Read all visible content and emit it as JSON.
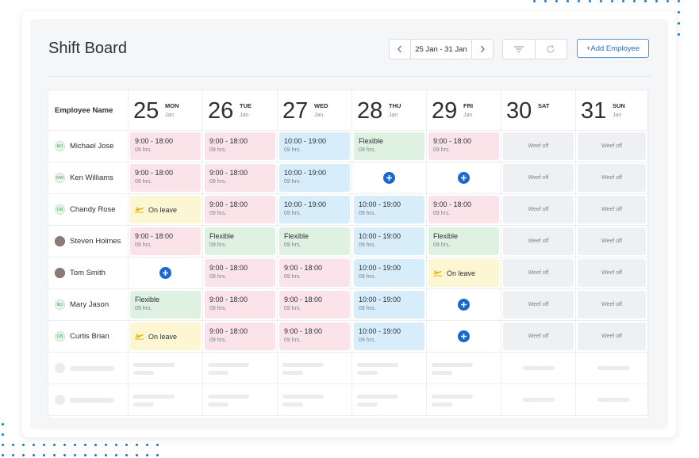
{
  "app": {
    "title": "Shift Board",
    "date_range": "25 Jan - 31 Jan",
    "add_employee_label": "+Add Employee",
    "accent_color": "#1769d1"
  },
  "icons": {
    "prev": "chevron-left-icon",
    "next": "chevron-right-icon",
    "filter": "filter-icon",
    "refresh": "refresh-icon",
    "add": "plus-circle-icon",
    "leave": "plane-icon"
  },
  "grid": {
    "employee_header": "Employee Name",
    "days": [
      {
        "num": "25",
        "name": "MON",
        "month": "Jan"
      },
      {
        "num": "26",
        "name": "TUE",
        "month": "Jan"
      },
      {
        "num": "27",
        "name": "WED",
        "month": "Jan"
      },
      {
        "num": "28",
        "name": "THU",
        "month": "Jan"
      },
      {
        "num": "29",
        "name": "FRI",
        "month": "Jan"
      },
      {
        "num": "30",
        "name": "SAT",
        "month": ""
      },
      {
        "num": "31",
        "name": "SUN",
        "month": "Jan"
      }
    ],
    "rows": [
      {
        "initials": "MJ",
        "name": "Michael Jose",
        "cells": [
          {
            "kind": "shift",
            "color": "pink",
            "time": "9:00 - 18:00",
            "hours": "09 hrs."
          },
          {
            "kind": "shift",
            "color": "pink",
            "time": "9:00 - 18:00",
            "hours": "09 hrs."
          },
          {
            "kind": "shift",
            "color": "blue",
            "time": "10:00 - 19:00",
            "hours": "09 hrs."
          },
          {
            "kind": "shift",
            "color": "green",
            "time": "Flexible",
            "hours": "09 hrs."
          },
          {
            "kind": "shift",
            "color": "pink",
            "time": "9:00 - 18:00",
            "hours": "09 hrs."
          },
          {
            "kind": "off",
            "label": "Weef off"
          },
          {
            "kind": "off",
            "label": "Weef off"
          }
        ]
      },
      {
        "initials": "KW",
        "name": "Ken Williams",
        "cells": [
          {
            "kind": "shift",
            "color": "pink",
            "time": "9:00 - 18:00",
            "hours": "09 hrs."
          },
          {
            "kind": "shift",
            "color": "pink",
            "time": "9:00 - 18:00",
            "hours": "09 hrs."
          },
          {
            "kind": "shift",
            "color": "blue",
            "time": "10:00 - 19:00",
            "hours": "09 hrs."
          },
          {
            "kind": "add"
          },
          {
            "kind": "add"
          },
          {
            "kind": "off",
            "label": "Weef off"
          },
          {
            "kind": "off",
            "label": "Weef off"
          }
        ]
      },
      {
        "initials": "CR",
        "name": "Chandy Rose",
        "cells": [
          {
            "kind": "leave",
            "label": "On leave"
          },
          {
            "kind": "shift",
            "color": "pink",
            "time": "9:00 - 18:00",
            "hours": "09 hrs."
          },
          {
            "kind": "shift",
            "color": "blue",
            "time": "10:00 - 19:00",
            "hours": "09 hrs."
          },
          {
            "kind": "shift",
            "color": "blue",
            "time": "10:00 - 19:00",
            "hours": "09 hrs."
          },
          {
            "kind": "shift",
            "color": "pink",
            "time": "9:00 - 18:00",
            "hours": "09 hrs."
          },
          {
            "kind": "off",
            "label": "Weef off"
          },
          {
            "kind": "off",
            "label": "Weef off"
          }
        ]
      },
      {
        "initials": "",
        "photo": true,
        "name": "Steven Holmes",
        "cells": [
          {
            "kind": "shift",
            "color": "pink",
            "time": "9:00 - 18:00",
            "hours": "09 hrs."
          },
          {
            "kind": "shift",
            "color": "green",
            "time": "Flexible",
            "hours": "09 hrs."
          },
          {
            "kind": "shift",
            "color": "green",
            "time": "Flexible",
            "hours": "09 hrs."
          },
          {
            "kind": "shift",
            "color": "blue",
            "time": "10:00 - 19:00",
            "hours": "09 hrs."
          },
          {
            "kind": "shift",
            "color": "green",
            "time": "Flexible",
            "hours": "09 hrs."
          },
          {
            "kind": "off",
            "label": "Weef off"
          },
          {
            "kind": "off",
            "label": "Weef off"
          }
        ]
      },
      {
        "initials": "",
        "photo": true,
        "name": "Tom Smith",
        "cells": [
          {
            "kind": "add"
          },
          {
            "kind": "shift",
            "color": "pink",
            "time": "9:00 - 18:00",
            "hours": "09 hrs."
          },
          {
            "kind": "shift",
            "color": "pink",
            "time": "9:00 - 18:00",
            "hours": "09 hrs."
          },
          {
            "kind": "shift",
            "color": "blue",
            "time": "10:00 - 19:00",
            "hours": "09 hrs."
          },
          {
            "kind": "leave",
            "label": "On leave"
          },
          {
            "kind": "off",
            "label": "Weef off"
          },
          {
            "kind": "off",
            "label": "Weef off"
          }
        ]
      },
      {
        "initials": "MJ",
        "name": "Mary Jason",
        "cells": [
          {
            "kind": "shift",
            "color": "green",
            "time": "Flexible",
            "hours": "09 hrs."
          },
          {
            "kind": "shift",
            "color": "pink",
            "time": "9:00 - 18:00",
            "hours": "09 hrs."
          },
          {
            "kind": "shift",
            "color": "pink",
            "time": "9:00 - 18:00",
            "hours": "09 hrs."
          },
          {
            "kind": "shift",
            "color": "blue",
            "time": "10:00 - 19:00",
            "hours": "09 hrs."
          },
          {
            "kind": "add"
          },
          {
            "kind": "off",
            "label": "Weef off"
          },
          {
            "kind": "off",
            "label": "Weef off"
          }
        ]
      },
      {
        "initials": "CB",
        "name": "Curtis Brian",
        "cells": [
          {
            "kind": "leave",
            "label": "On leave"
          },
          {
            "kind": "shift",
            "color": "pink",
            "time": "9:00 - 18:00",
            "hours": "09 hrs."
          },
          {
            "kind": "shift",
            "color": "pink",
            "time": "9:00 - 18:00",
            "hours": "09 hrs."
          },
          {
            "kind": "shift",
            "color": "blue",
            "time": "10:00 - 19:00",
            "hours": "09 hrs."
          },
          {
            "kind": "add"
          },
          {
            "kind": "off",
            "label": "Weef off"
          },
          {
            "kind": "off",
            "label": "Weef off"
          }
        ]
      }
    ]
  }
}
